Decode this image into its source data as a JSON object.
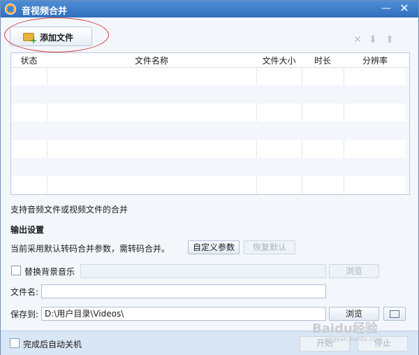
{
  "window": {
    "title": "音视频合并",
    "minimize": "—",
    "close": "✕"
  },
  "toolbar": {
    "add_label": "添加文件",
    "icons": [
      "remove-icon",
      "move-down-icon",
      "move-up-icon"
    ],
    "icon_glyphs": [
      "✕",
      "⬇",
      "⬆"
    ]
  },
  "table": {
    "columns": [
      "状态",
      "文件名称",
      "文件大小",
      "时长",
      "分辨率"
    ]
  },
  "main": {
    "support_text": "支持音频文件或视频文件的合并",
    "output_title": "输出设置",
    "default_text": "当前采用默认转码合并参数，需转码合并。",
    "custom_button": "自定义参数",
    "restore_button": "恢复默认",
    "background_music_label": "替换背景音乐",
    "browse_label": "浏览",
    "filename_label": "文件名:",
    "save_label": "保存到:",
    "save_path": "D:\\用户目录\\Videos\\"
  },
  "footer": {
    "auto_shutdown": "完成后自动关机",
    "start": "开始",
    "stop": "停止"
  },
  "watermark": {
    "main": "Baidu经验",
    "sub": "jingyan.baidu.com"
  }
}
